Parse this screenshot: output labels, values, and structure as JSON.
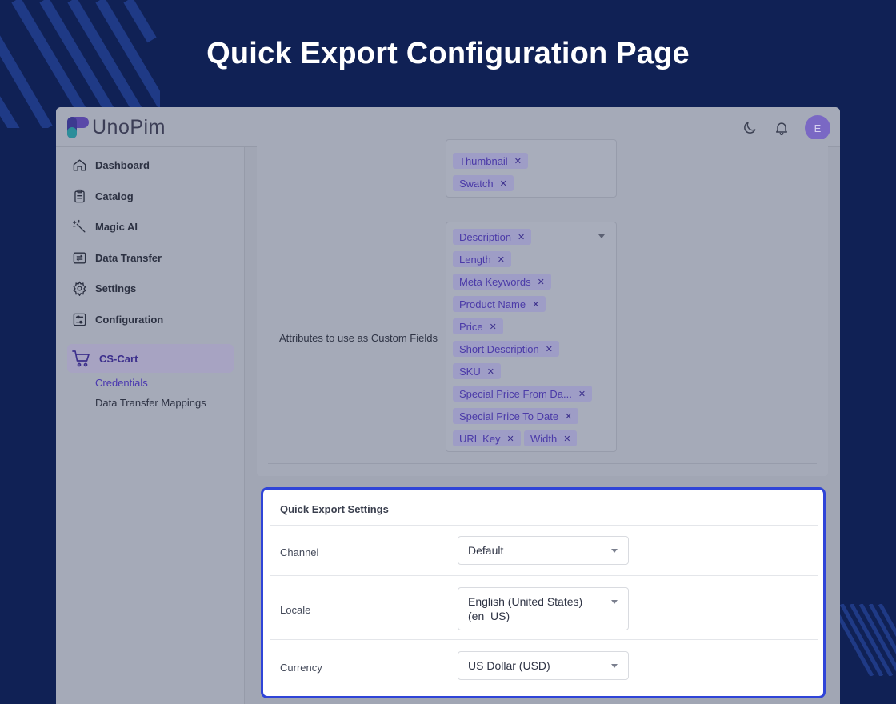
{
  "banner": {
    "title": "Quick Export Configuration Page"
  },
  "app": {
    "logo_text": "UnoPim",
    "avatar_initial": "E",
    "icons": {
      "theme": "moon-icon",
      "notifications": "bell-icon"
    },
    "colors": {
      "accent": "#7a68c4",
      "highlight_border": "#2f44d8",
      "tag_text": "#4b3aa8"
    }
  },
  "sidebar": {
    "items": [
      {
        "label": "Dashboard",
        "icon": "home-icon"
      },
      {
        "label": "Catalog",
        "icon": "clipboard-icon"
      },
      {
        "label": "Magic AI",
        "icon": "magic-wand-icon"
      },
      {
        "label": "Data Transfer",
        "icon": "transfer-icon"
      },
      {
        "label": "Settings",
        "icon": "gear-icon"
      },
      {
        "label": "Configuration",
        "icon": "sliders-icon"
      }
    ],
    "active_section": {
      "label": "CS-Cart",
      "icon": "cart-icon"
    },
    "sub_items": [
      {
        "label": "Credentials"
      },
      {
        "label": "Data Transfer Mappings"
      }
    ]
  },
  "media_field": {
    "tags": [
      "Thumbnail",
      "Swatch"
    ]
  },
  "custom_fields": {
    "label": "Attributes to use as Custom Fields",
    "tags": [
      "Description",
      "Length",
      "Meta Keywords",
      "Product Name",
      "Price",
      "Short Description",
      "SKU",
      "Special Price From Da...",
      "Special Price To Date",
      "URL Key",
      "Width"
    ]
  },
  "quick_export": {
    "title": "Quick Export Settings",
    "channel": {
      "label": "Channel",
      "value": "Default"
    },
    "locale": {
      "label": "Locale",
      "value": "English (United States) (en_US)"
    },
    "currency": {
      "label": "Currency",
      "value": "US Dollar (USD)"
    }
  }
}
